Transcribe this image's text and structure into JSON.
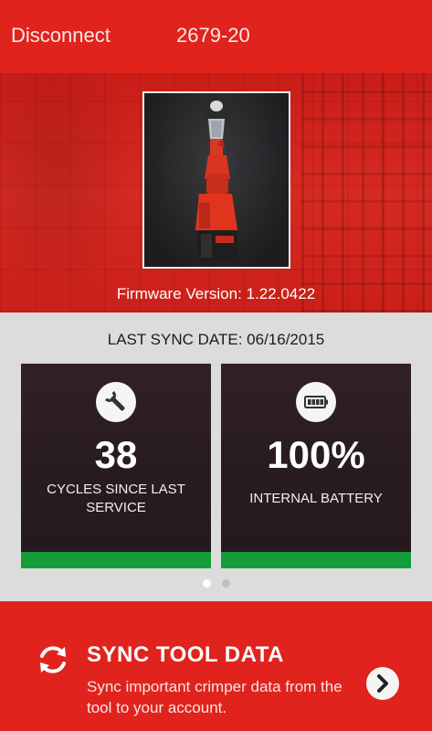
{
  "header": {
    "disconnect_label": "Disconnect",
    "model": "2679-20"
  },
  "device": {
    "image_icon": "crimper-tool-image",
    "firmware": "Firmware Version: 1.22.0422"
  },
  "status": {
    "last_sync": "LAST SYNC DATE: 06/16/2015",
    "cards": [
      {
        "icon": "wrench-icon",
        "value": "38",
        "label": "CYCLES SINCE LAST SERVICE",
        "bar_color": "#139d3a"
      },
      {
        "icon": "battery-icon",
        "value": "100%",
        "label": "INTERNAL BATTERY",
        "bar_color": "#139d3a"
      }
    ],
    "pager": {
      "count": 2,
      "active": 1
    }
  },
  "sync": {
    "icon": "sync-icon",
    "title": "SYNC TOOL DATA",
    "description": "Sync important crimper data from the tool to your account.",
    "next_icon": "chevron-right-icon"
  },
  "colors": {
    "brand_red": "#e0231d",
    "status_green": "#139d3a",
    "card_dark": "#2a1d22"
  }
}
